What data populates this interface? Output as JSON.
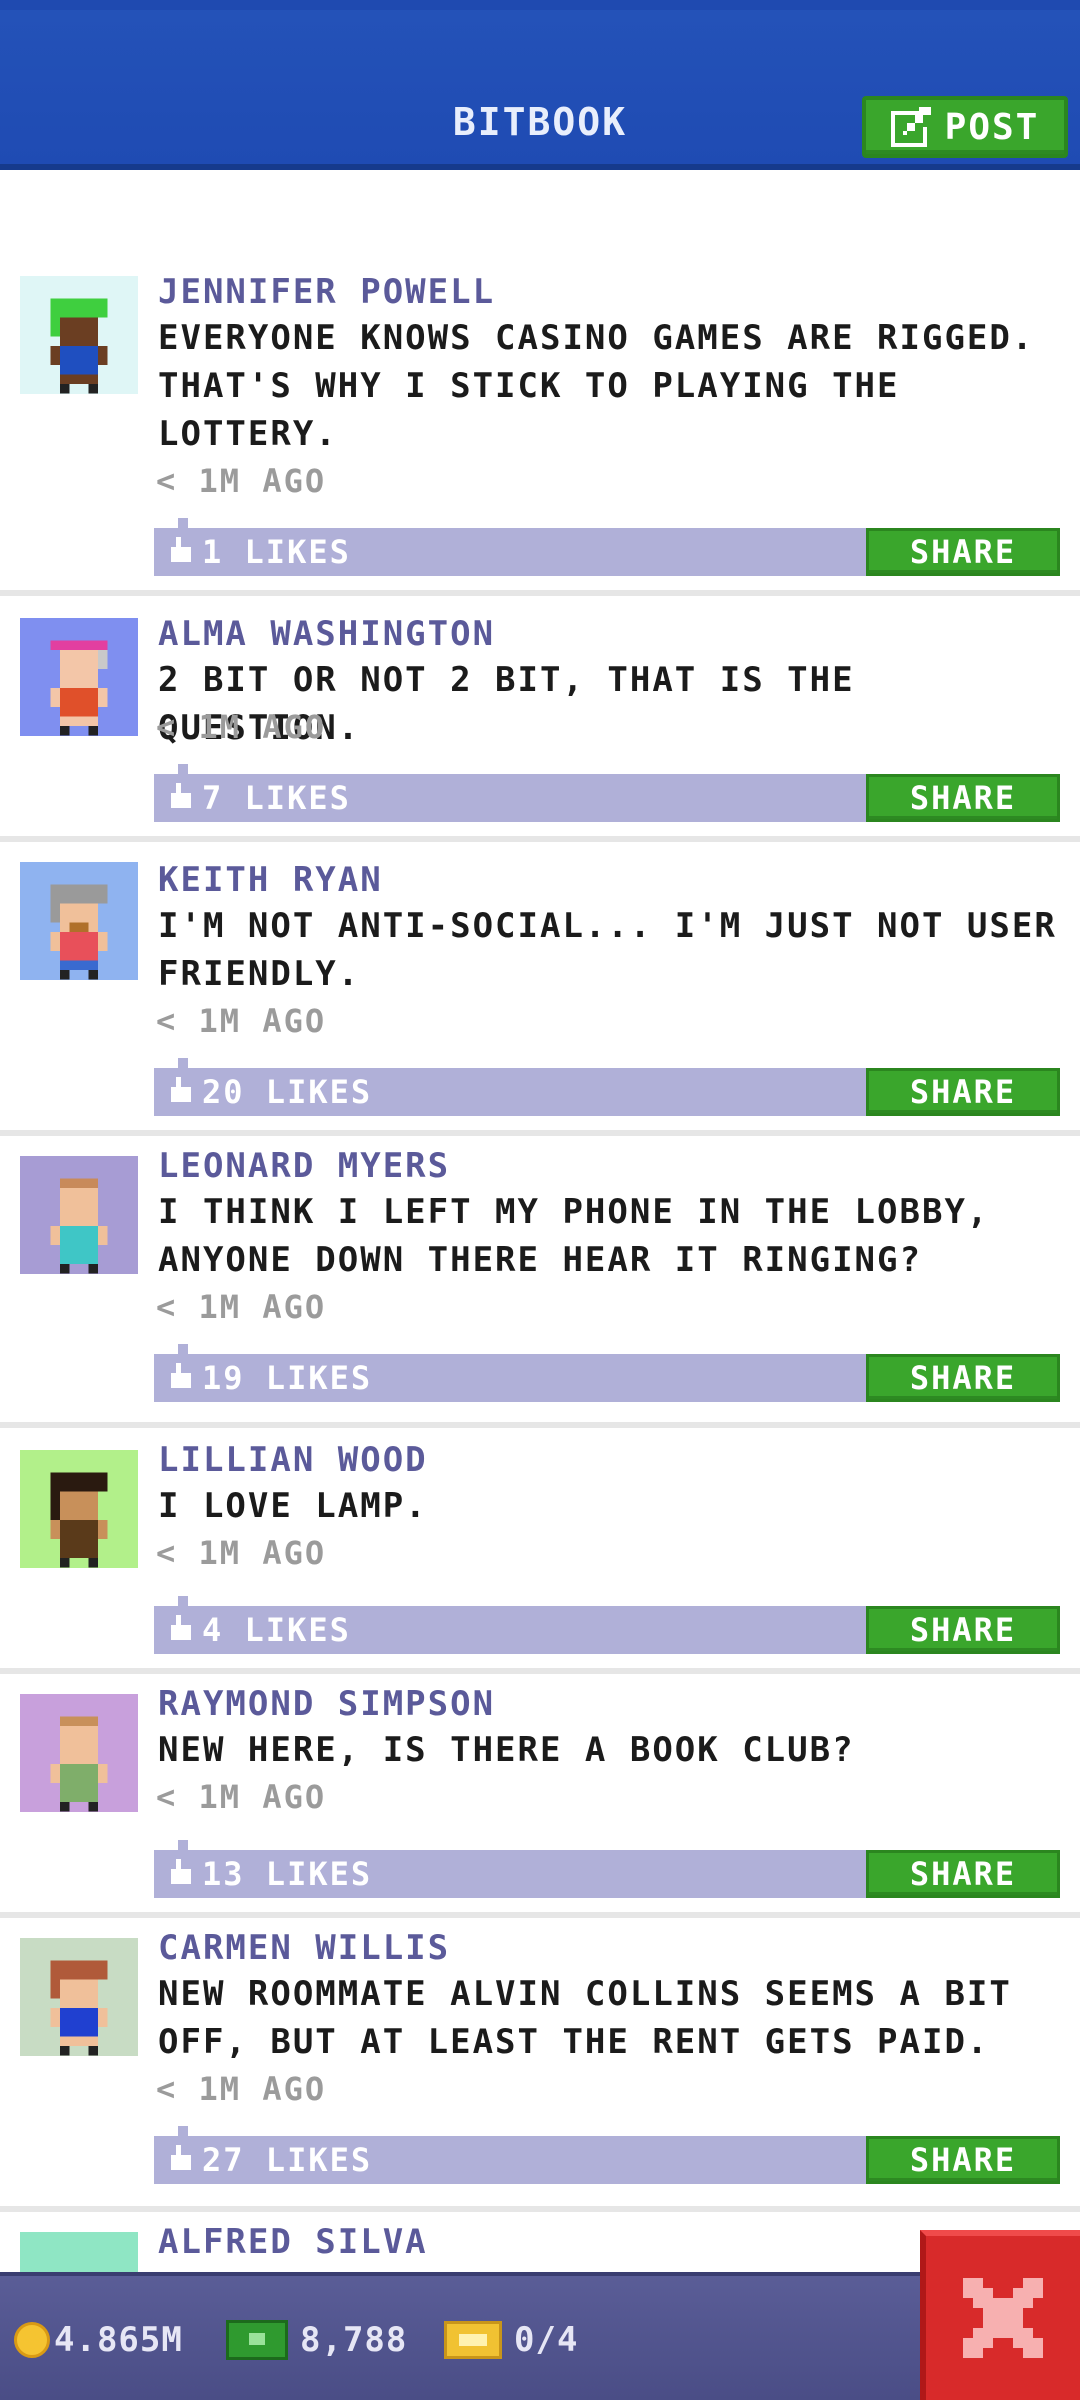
{
  "header": {
    "title": "BITBOOK",
    "post_label": "POST"
  },
  "posts": [
    {
      "name": "JENNIFER POWELL",
      "text": "EVERYONE KNOWS CASINO GAMES ARE RIGGED. THAT'S WHY I STICK TO PLAYING THE LOTTERY.",
      "time": "< 1M AGO",
      "likes": "1 LIKES",
      "share": "SHARE"
    },
    {
      "name": "ALMA WASHINGTON",
      "text": "2 BIT OR NOT 2 BIT, THAT IS THE QUESTION.",
      "time": "< 1M AGO",
      "likes": "7 LIKES",
      "share": "SHARE"
    },
    {
      "name": "KEITH RYAN",
      "text": "I'M NOT ANTI-SOCIAL... I'M JUST NOT USER FRIENDLY.",
      "time": "< 1M AGO",
      "likes": "20 LIKES",
      "share": "SHARE"
    },
    {
      "name": "LEONARD MYERS",
      "text": "I THINK I LEFT MY PHONE IN THE LOBBY, ANYONE DOWN THERE HEAR IT RINGING?",
      "time": "< 1M AGO",
      "likes": "19 LIKES",
      "share": "SHARE"
    },
    {
      "name": "LILLIAN WOOD",
      "text": "I LOVE LAMP.",
      "time": "< 1M AGO",
      "likes": "4 LIKES",
      "share": "SHARE"
    },
    {
      "name": "RAYMOND SIMPSON",
      "text": "NEW HERE, IS THERE A BOOK CLUB?",
      "time": "< 1M AGO",
      "likes": "13 LIKES",
      "share": "SHARE"
    },
    {
      "name": "CARMEN WILLIS",
      "text": "NEW ROOMMATE ALVIN COLLINS SEEMS A BIT OFF, BUT AT LEAST THE RENT GETS PAID.",
      "time": "< 1M AGO",
      "likes": "27 LIKES",
      "share": "SHARE"
    },
    {
      "name": "ALFRED SILVA"
    }
  ],
  "status_bar": {
    "coins": "4.865M",
    "bux": "8,788",
    "tickets": "0/4"
  },
  "colors": {
    "header": "#1f4bb3",
    "accent_green": "#3aa62c",
    "likes_bar": "#b0b0d8",
    "name": "#5b5a9a",
    "close": "#d82a2a"
  }
}
